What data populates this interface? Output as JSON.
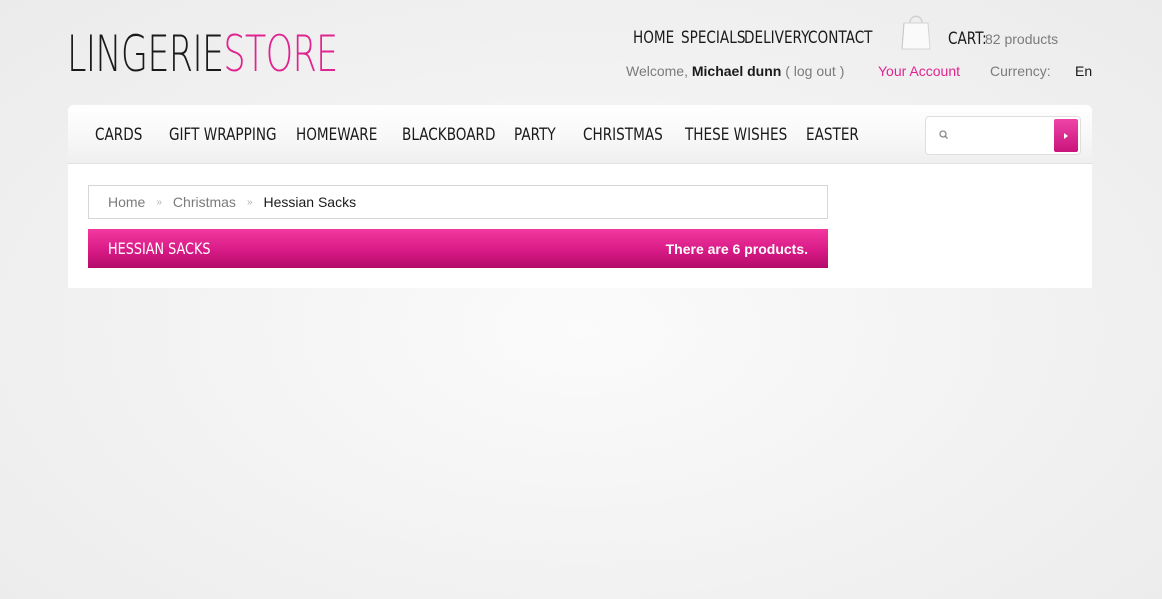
{
  "logo": {
    "part1": "LINGERIE",
    "part2": "STORE"
  },
  "top_nav": [
    {
      "label": "HOME"
    },
    {
      "label": "SPECIALS"
    },
    {
      "label": "DELIVERY"
    },
    {
      "label": "CONTACT"
    }
  ],
  "cart": {
    "label": "CART:",
    "count": "82 products",
    "icon": "shopping-bag-icon"
  },
  "welcome": {
    "label": "Welcome,",
    "user": "Michael dunn",
    "logout": "( log out )"
  },
  "account": {
    "label": "Your Account"
  },
  "currency": {
    "label": "Currency:"
  },
  "language": {
    "value": "En"
  },
  "categories": [
    {
      "label": "CARDS"
    },
    {
      "label": "GIFT WRAPPING"
    },
    {
      "label": "HOMEWARE"
    },
    {
      "label": "BLACKBOARD"
    },
    {
      "label": "PARTY"
    },
    {
      "label": "CHRISTMAS"
    },
    {
      "label": "THESE WISHES"
    },
    {
      "label": "EASTER"
    }
  ],
  "search": {
    "placeholder": "",
    "value": "",
    "icon": "search-icon"
  },
  "breadcrumb": {
    "items": [
      {
        "label": "Home"
      },
      {
        "label": "Christmas"
      }
    ],
    "separator": "»",
    "current": "Hessian Sacks"
  },
  "category_heading": {
    "title": "HESSIAN SACKS",
    "count_text": "There are 6 products."
  },
  "colors": {
    "accent": "#e0248f",
    "text": "#1a1a1a",
    "muted": "#7b7b7b"
  }
}
